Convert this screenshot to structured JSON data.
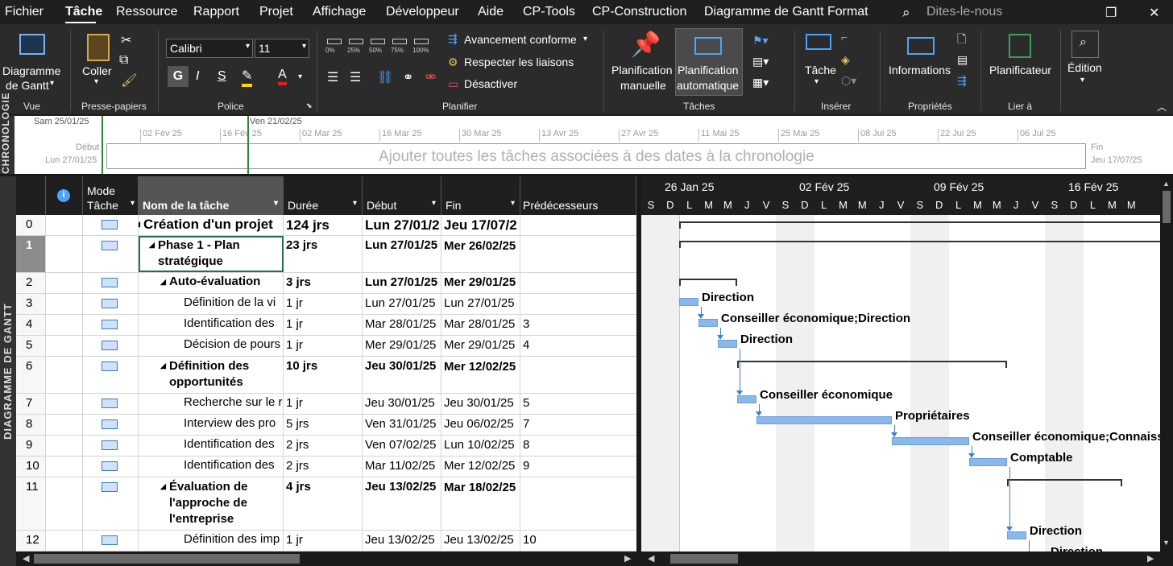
{
  "menu": {
    "items": [
      "Fichier",
      "Tâche",
      "Ressource",
      "Rapport",
      "Projet",
      "Affichage",
      "Développeur",
      "Aide",
      "CP-Tools",
      "CP-Construction",
      "Diagramme de Gantt Format"
    ],
    "search_placeholder": "Dites-le-nous"
  },
  "ribbon": {
    "vue": {
      "label1": "Diagramme",
      "label2": "de Gantt",
      "group": "Vue"
    },
    "presse": {
      "coller": "Coller",
      "group": "Presse-papiers"
    },
    "police": {
      "font": "Calibri",
      "size": "11",
      "bold": "G",
      "italic": "I",
      "underline": "S",
      "group": "Police"
    },
    "planifier": {
      "pcts": [
        "0%",
        "25%",
        "50%",
        "75%",
        "100%"
      ],
      "avancement": "Avancement conforme",
      "respecter": "Respecter les liaisons",
      "desactiver": "Désactiver",
      "group": "Planifier"
    },
    "taches": {
      "manuelle1": "Planification",
      "manuelle2": "manuelle",
      "auto1": "Planification",
      "auto2": "automatique",
      "group": "Tâches"
    },
    "inserer": {
      "tache": "Tâche",
      "group": "Insérer"
    },
    "proprietes": {
      "info": "Informations",
      "group": "Propriétés"
    },
    "lier": {
      "planificateur": "Planificateur",
      "group": "Lier à"
    },
    "edition": {
      "label": "Édition"
    }
  },
  "timeline": {
    "tab": "CHRONOLOGIE",
    "today": "Sam 25/01/25",
    "marker": "Ven 21/02/25",
    "ticks": [
      "02 Fév 25",
      "16 Fév 25",
      "02 Mar 25",
      "16 Mar 25",
      "30 Mar 25",
      "13 Avr 25",
      "27 Avr 25",
      "11 Mai 25",
      "25 Mai 25",
      "08 Jui 25",
      "22 Jui 25",
      "06 Jul 25"
    ],
    "debut_label": "Début",
    "debut_date": "Lun 27/01/25",
    "fin_label": "Fin",
    "fin_date": "Jeu 17/07/25",
    "placeholder": "Ajouter toutes les tâches associées à des dates à la chronologie"
  },
  "grid": {
    "side_tab": "DIAGRAMME DE GANTT",
    "headers": {
      "mode1": "Mode",
      "mode2": "Tâche",
      "name": "Nom de la tâche",
      "duree": "Durée",
      "debut": "Début",
      "fin": "Fin",
      "pred": "Prédécesseurs"
    },
    "rows": [
      {
        "id": "0",
        "name": "Création d'un projet",
        "duree": "124 jrs",
        "debut": "Lun 27/01/2",
        "fin": "Jeu 17/07/2",
        "pred": ""
      },
      {
        "id": "1",
        "name": "Phase 1 - Plan stratégique",
        "duree": "23 jrs",
        "debut": "Lun 27/01/25",
        "fin": "Mer 26/02/25",
        "pred": ""
      },
      {
        "id": "2",
        "name": "Auto-évaluation",
        "duree": "3 jrs",
        "debut": "Lun 27/01/25",
        "fin": "Mer 29/01/25",
        "pred": ""
      },
      {
        "id": "3",
        "name": "Définition de la vi",
        "duree": "1 jr",
        "debut": "Lun 27/01/25",
        "fin": "Lun 27/01/25",
        "pred": ""
      },
      {
        "id": "4",
        "name": "Identification des",
        "duree": "1 jr",
        "debut": "Mar 28/01/25",
        "fin": "Mar 28/01/25",
        "pred": "3"
      },
      {
        "id": "5",
        "name": "Décision de pours",
        "duree": "1 jr",
        "debut": "Mer 29/01/25",
        "fin": "Mer 29/01/25",
        "pred": "4"
      },
      {
        "id": "6",
        "name": "Définition des opportunités",
        "duree": "10 jrs",
        "debut": "Jeu 30/01/25",
        "fin": "Mer 12/02/25",
        "pred": ""
      },
      {
        "id": "7",
        "name": "Recherche sur le r",
        "duree": "1 jr",
        "debut": "Jeu 30/01/25",
        "fin": "Jeu 30/01/25",
        "pred": "5"
      },
      {
        "id": "8",
        "name": "Interview des pro",
        "duree": "5 jrs",
        "debut": "Ven 31/01/25",
        "fin": "Jeu 06/02/25",
        "pred": "7"
      },
      {
        "id": "9",
        "name": "Identification des",
        "duree": "2 jrs",
        "debut": "Ven 07/02/25",
        "fin": "Lun 10/02/25",
        "pred": "8"
      },
      {
        "id": "10",
        "name": "Identification des",
        "duree": "2 jrs",
        "debut": "Mar 11/02/25",
        "fin": "Mer 12/02/25",
        "pred": "9"
      },
      {
        "id": "11",
        "name": "Évaluation de l'approche de l'entreprise",
        "duree": "4 jrs",
        "debut": "Jeu 13/02/25",
        "fin": "Mar 18/02/25",
        "pred": ""
      },
      {
        "id": "12",
        "name": "Définition des imp",
        "duree": "1 jr",
        "debut": "Jeu 13/02/25",
        "fin": "Jeu 13/02/25",
        "pred": "10"
      }
    ]
  },
  "gantt": {
    "weeks": [
      "26 Jan 25",
      "02 Fév 25",
      "09 Fév 25",
      "16 Fév 25"
    ],
    "days": [
      "S",
      "D",
      "L",
      "M",
      "M",
      "J",
      "V",
      "S",
      "D",
      "L",
      "M",
      "M",
      "J",
      "V",
      "S",
      "D",
      "L",
      "M",
      "M",
      "J",
      "V",
      "S",
      "D",
      "L",
      "M",
      "M"
    ],
    "labels": [
      "Direction",
      "Conseiller économique;Direction",
      "Direction",
      "Conseiller économique",
      "Propriétaires",
      "Conseiller économique;Connaiss",
      "Comptable",
      "Direction",
      "Direction"
    ]
  },
  "colors": {
    "accent": "#3b7fd4",
    "bar": "#8ab8ec",
    "ribbon": "#2b2b2b",
    "header": "#1f1f1f"
  }
}
